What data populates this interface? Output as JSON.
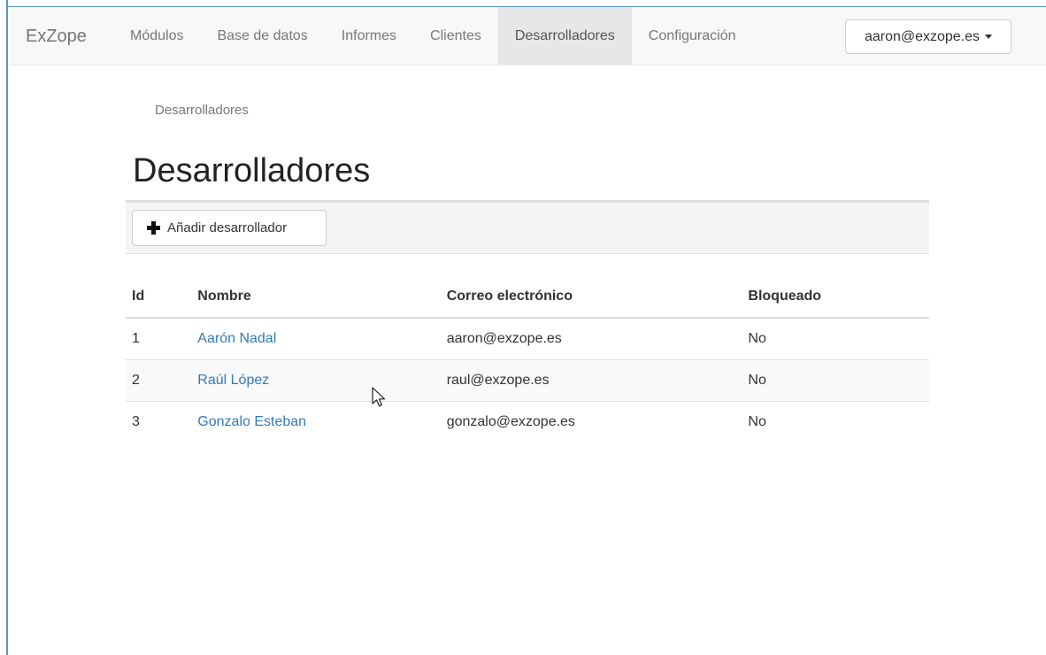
{
  "app": {
    "brand": "ExZope"
  },
  "nav": {
    "items": [
      {
        "label": "Módulos"
      },
      {
        "label": "Base de datos"
      },
      {
        "label": "Informes"
      },
      {
        "label": "Clientes"
      },
      {
        "label": "Desarrolladores",
        "active": true
      },
      {
        "label": "Configuración"
      }
    ],
    "user": "aaron@exzope.es"
  },
  "breadcrumb": "Desarrolladores",
  "title": "Desarrolladores",
  "toolbar": {
    "add_label": "Añadir desarrollador",
    "add_icon": "plus-icon"
  },
  "table": {
    "headers": [
      "Id",
      "Nombre",
      "Correo electrónico",
      "Bloqueado"
    ],
    "rows": [
      {
        "id": "1",
        "name": "Aarón Nadal",
        "email": "aaron@exzope.es",
        "blocked": "No"
      },
      {
        "id": "2",
        "name": "Raúl López",
        "email": "raul@exzope.es",
        "blocked": "No"
      },
      {
        "id": "3",
        "name": "Gonzalo Esteban",
        "email": "gonzalo@exzope.es",
        "blocked": "No"
      }
    ]
  },
  "colors": {
    "link": "#337ab7",
    "navbar_bg": "#f8f8f8",
    "active_nav_bg": "#e7e7e7",
    "window_accent": "#5a93d4"
  }
}
